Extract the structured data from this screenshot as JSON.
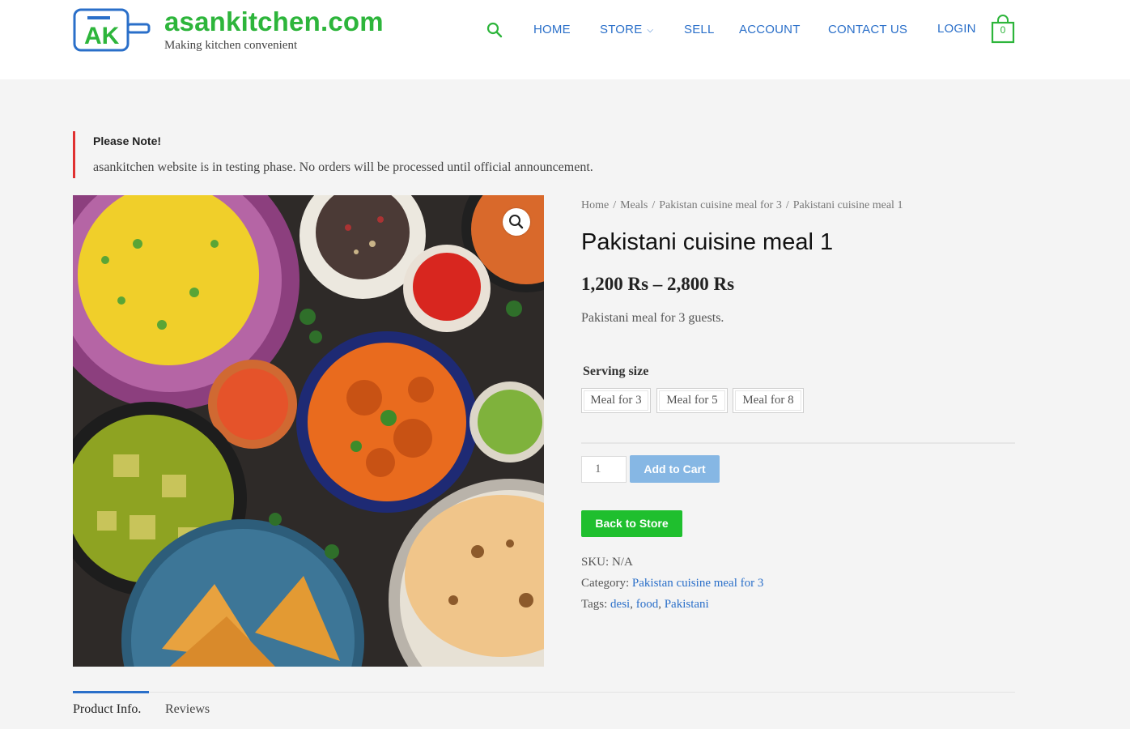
{
  "header": {
    "logo_text": "AK",
    "site_title": "asankitchen.com",
    "tagline": "Making kitchen convenient",
    "nav": {
      "home": "HOME",
      "store": "STORE",
      "sell": "SELL",
      "account": "ACCOUNT",
      "contact": "CONTACT US",
      "login": "LOGIN"
    },
    "cart_count": "0",
    "accent_green": "#2db53b",
    "link_blue": "#2a6fc9"
  },
  "notice": {
    "title": "Please Note!",
    "text": "asankitchen website is in testing phase. No orders will be processed until official announcement."
  },
  "breadcrumb": [
    "Home",
    "Meals",
    "Pakistan cuisine meal for 3",
    "Pakistani cuisine meal 1"
  ],
  "product": {
    "title": "Pakistani cuisine meal 1",
    "price": "1,200 Rs – 2,800 Rs",
    "short_description": "Pakistani meal for 3 guests.",
    "attribute_label": "Serving size",
    "serving_options": [
      "Meal for 3",
      "Meal for 5",
      "Meal for 8"
    ],
    "quantity": "1",
    "add_to_cart": "Add to Cart",
    "back_to_store": "Back to Store",
    "sku_label": "SKU:",
    "sku_value": "N/A",
    "category_label": "Category:",
    "category_value": "Pakistan cuisine meal for 3",
    "tags_label": "Tags:",
    "tags": [
      "desi",
      "food",
      "Pakistani"
    ]
  },
  "tabs": {
    "info": "Product Info.",
    "reviews": "Reviews"
  }
}
